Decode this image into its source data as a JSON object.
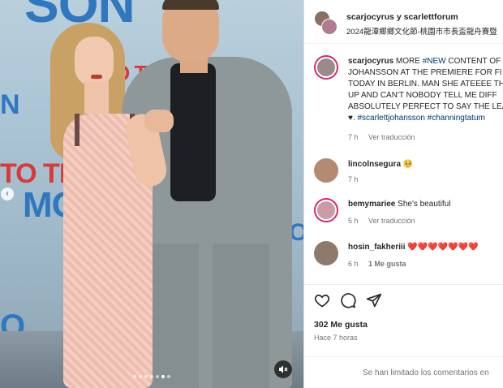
{
  "post": {
    "header": {
      "users": "scarjocyrus y scarlettforum",
      "location": "2024龍潭鄉鄉文化節-桃園市市長盃龍舟賽暨"
    },
    "caption": {
      "username": "scarjocyrus",
      "text_1": " MORE ",
      "hashtag_new": "#NEW",
      "text_2": " CONTENT OF JOHANSSON AT THE PREMIERE FOR FI TODAY IN BERLIN. MAN SHE ATEEEE TH UP AND CAN'T NOBODY TELL ME DIFF ABSOLUTELY PERFECT TO SAY THE LEA ",
      "heart": "♥.",
      "hashtag_1": "#scarlettjohansson",
      "hashtag_2": "#channingtatum",
      "time": "7 h",
      "translate": "Ver traducción"
    },
    "comments": [
      {
        "username": "lincolnsegura",
        "text": "🥺",
        "time": "7 h",
        "extra": ""
      },
      {
        "username": "bemymariee",
        "text": "She's beautiful",
        "time": "5 h",
        "extra": "Ver traducción"
      },
      {
        "username": "hosin_fakheriii",
        "text": "❤️❤️❤️❤️❤️❤️❤️",
        "time": "6 h",
        "extra": "1 Me gusta"
      }
    ],
    "likes": "302 Me gusta",
    "posted": "Hace 7 horas",
    "comments_limited": "Se han limitado los comentarios en"
  },
  "media": {
    "prev_arrow": "‹",
    "slide_count": 7,
    "active_slide": 6
  },
  "colors": {
    "hashtag": "#00376b",
    "story_ring": "#d62976",
    "muted_text": "#737373"
  },
  "icons": [
    "heart-icon",
    "comment-icon",
    "share-icon",
    "mute-icon",
    "chevron-left-icon"
  ]
}
